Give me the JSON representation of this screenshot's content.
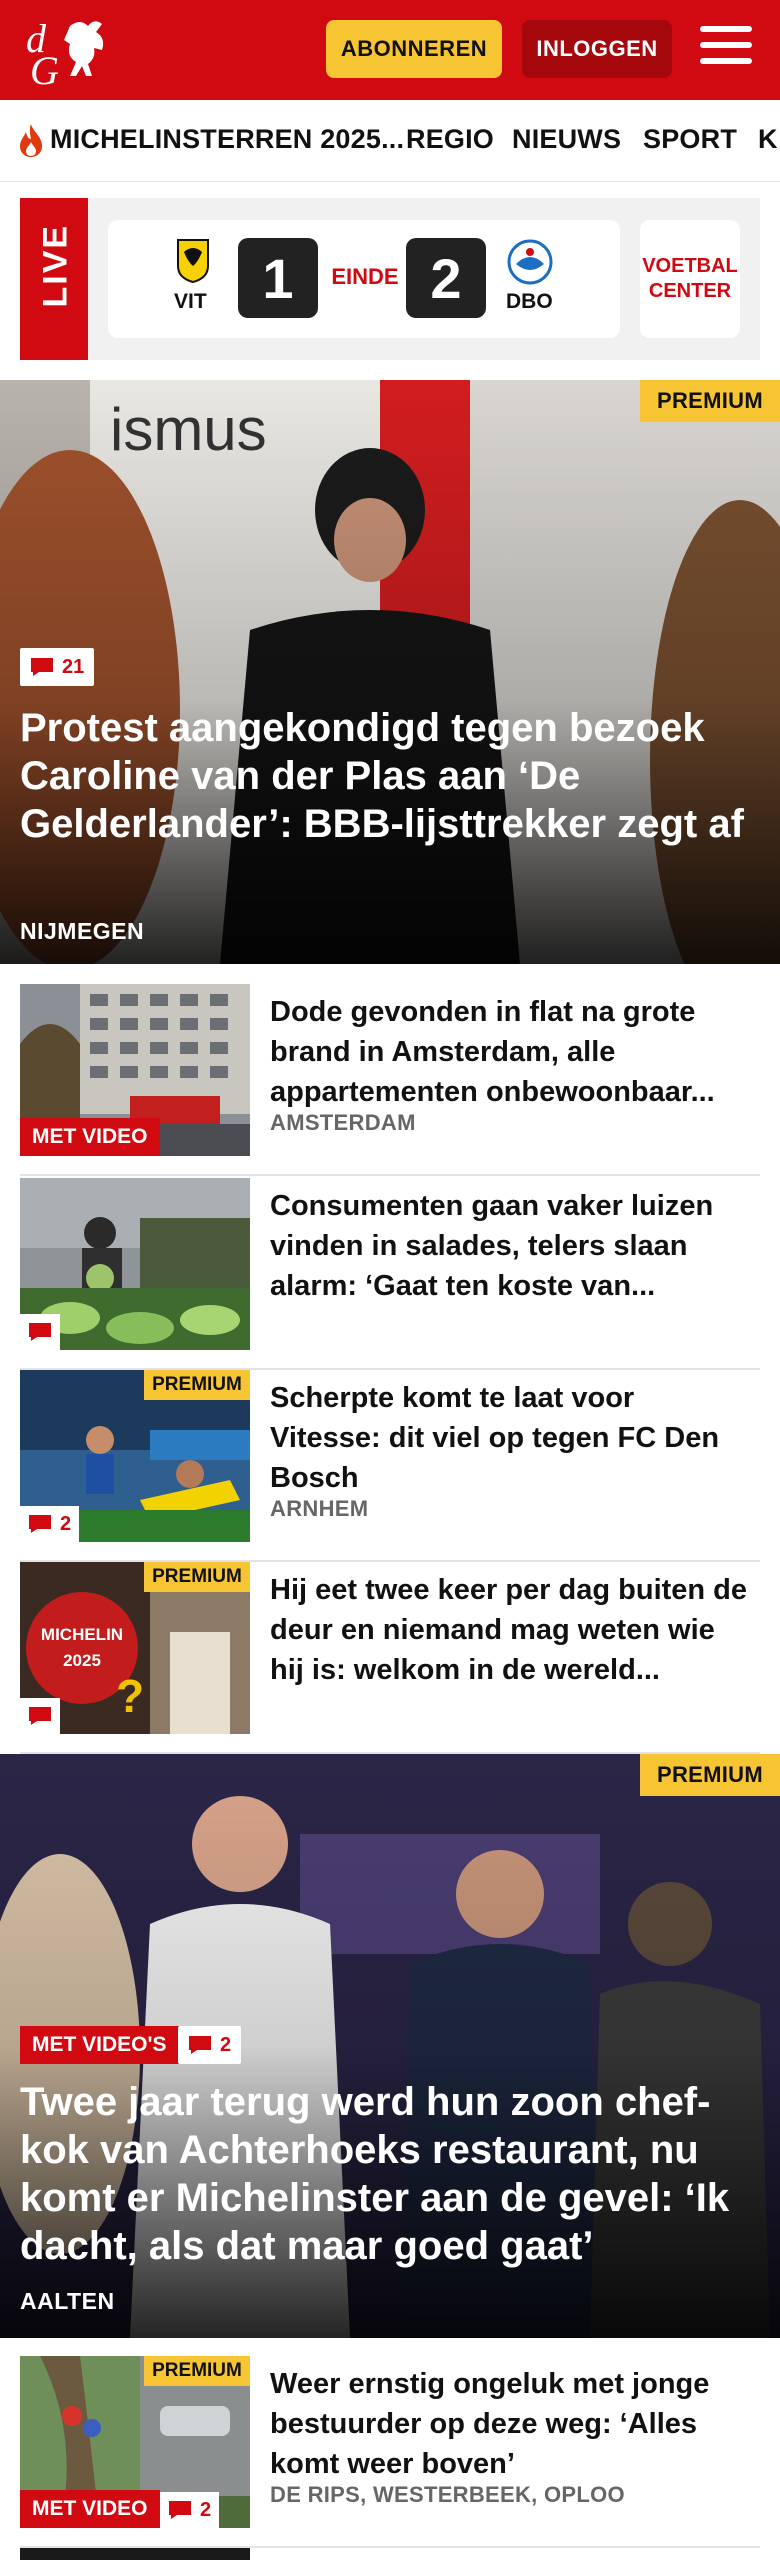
{
  "header": {
    "brand_name": "dG",
    "subscribe_label": "ABONNEREN",
    "login_label": "INLOGGEN",
    "brand_color": "#d10a11",
    "accent_color": "#f7c534"
  },
  "nav": {
    "items": [
      {
        "label": "MICHELINSTERREN 2025...",
        "icon": "flame-icon"
      },
      {
        "label": "REGIO"
      },
      {
        "label": "NIEUWS"
      },
      {
        "label": "SPORT"
      },
      {
        "label": "K"
      }
    ]
  },
  "live": {
    "tag": "LIVE",
    "home_team": "VIT",
    "away_team": "DBO",
    "home_score": "1",
    "away_score": "2",
    "status": "EINDE",
    "voetbal_center_line1": "VOETBAL",
    "voetbal_center_line2": "CENTER"
  },
  "articles": [
    {
      "title": "Protest aangekondigd tegen bezoek Caroline van der Plas aan ‘De Gelderlander’: BBB-lijsttrekker zegt af",
      "location": "NIJMEGEN",
      "premium": "PREMIUM",
      "comments": "21"
    },
    {
      "title": "Dode gevonden in flat na grote brand in Amsterdam, alle appartementen onbewoonbaar...",
      "location": "AMSTERDAM",
      "video": "MET VIDEO"
    },
    {
      "title": "Consumenten gaan vaker luizen vinden in salades, telers slaan alarm: ‘Gaat ten koste van...",
      "location": ""
    },
    {
      "title": "Scherpte komt te laat voor Vitesse: dit viel op tegen FC Den Bosch",
      "location": "ARNHEM",
      "premium": "PREMIUM",
      "comments": "2"
    },
    {
      "title": "Hij eet twee keer per dag buiten de deur en niemand mag weten wie hij is: welkom in de wereld...",
      "location": "",
      "premium": "PREMIUM",
      "image_text_1": "MICHELIN",
      "image_text_2": "2025"
    },
    {
      "title": "Twee jaar terug werd hun zoon chef-kok van Achterhoeks restaurant, nu komt er Michelinster aan de gevel: ‘Ik dacht, als dat maar goed gaat’",
      "location": "AALTEN",
      "premium": "PREMIUM",
      "video": "MET VIDEO'S",
      "comments": "2"
    },
    {
      "title": "Weer ernstig ongeluk met jonge bestuurder op deze weg: ‘Alles komt weer boven’",
      "location": "DE RIPS, WESTERBEEK, OPLOO",
      "premium": "PREMIUM",
      "video": "MET VIDEO",
      "comments": "2"
    }
  ]
}
